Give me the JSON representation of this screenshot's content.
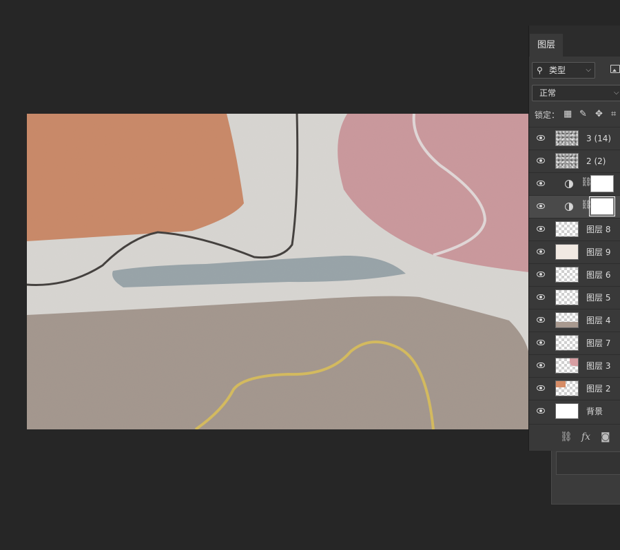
{
  "panel": {
    "tab_label": "图层",
    "filter": {
      "icon": "search-icon",
      "label": "类型",
      "chevron": "⌵"
    },
    "blend_mode": {
      "label": "正常",
      "chevron": "⌵"
    },
    "lock_label": "锁定：",
    "lock_icons": [
      "checker-lock-icon",
      "brush-lock-icon",
      "move-lock-icon",
      "artboard-lock-icon"
    ]
  },
  "layers": [
    {
      "name": "3 (14)",
      "thumb": "texture"
    },
    {
      "name": "2 (2)",
      "thumb": "texture"
    },
    {
      "name": "",
      "type": "adjustment",
      "chain": "⛓"
    },
    {
      "name": "",
      "type": "adjustment",
      "chain": "⛓",
      "selected": true
    },
    {
      "name": "图层 8",
      "thumb": "checker"
    },
    {
      "name": "图层 9",
      "thumb": "cream"
    },
    {
      "name": "图层 6",
      "thumb": "checker"
    },
    {
      "name": "图层 5",
      "thumb": "checker"
    },
    {
      "name": "图层 4",
      "thumb": "checker-brown"
    },
    {
      "name": "图层 7",
      "thumb": "checker"
    },
    {
      "name": "图层 3",
      "thumb": "checker-pink"
    },
    {
      "name": "图层 2",
      "thumb": "checker-orange"
    },
    {
      "name": "背景",
      "thumb": "white"
    }
  ],
  "footer": {
    "link_icon": "⛓",
    "fx_label": "fx",
    "mask_icon": "◙"
  },
  "colors": {
    "orange": "#d98a63",
    "pink": "#d49a9f",
    "slate": "#9aa8ae",
    "brown": "#a8998f",
    "gold": "#e2c35a",
    "canvas_bg": "#e6e3df"
  }
}
